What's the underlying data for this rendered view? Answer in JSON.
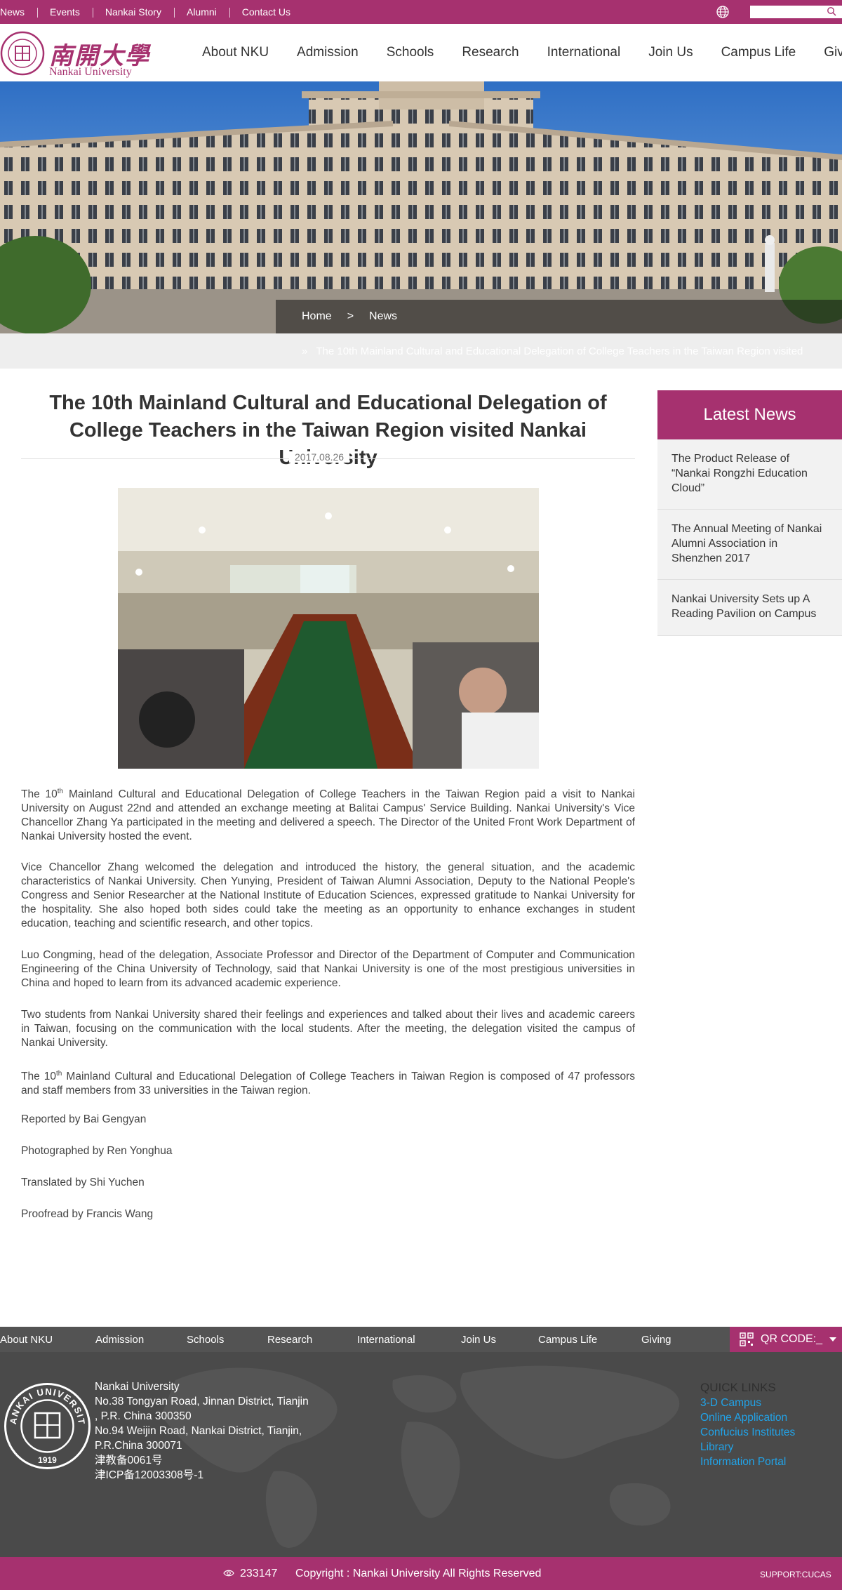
{
  "topbar": {
    "links": [
      "News",
      "Events",
      "Nankai Story",
      "Alumni",
      "Contact Us"
    ],
    "search_placeholder": ""
  },
  "header": {
    "logo_cn": "南開大學",
    "logo_en": "Nankai University",
    "nav": [
      "About NKU",
      "Admission",
      "Schools",
      "Research",
      "International",
      "Join Us",
      "Campus Life",
      "Giving"
    ]
  },
  "breadcrumb": {
    "home": "Home",
    "separator": ">",
    "current": "News",
    "trail_arrow": "»",
    "trail_title": "The 10th Mainland Cultural and Educational Delegation of College Teachers in the Taiwan Region visited"
  },
  "article": {
    "title_line1": "The 10th Mainland Cultural and Educational Delegation of",
    "title_line2": "College Teachers in the Taiwan Region visited Nankai University",
    "date": "2017.08.26",
    "p1_a": "The 10",
    "p1_sup": "th",
    "p1_b": " Mainland Cultural and Educational Delegation of College Teachers in the Taiwan Region paid a visit to Nankai University on August 22nd and attended an exchange meeting at Balitai Campus' Service Building. Nankai University's Vice Chancellor Zhang Ya participated in the meeting and delivered a speech. The Director of the United Front Work Department of Nankai University hosted the event.",
    "p2": "Vice Chancellor Zhang welcomed the delegation and introduced the history, the general situation, and the academic characteristics of Nankai University. Chen Yunying, President of Taiwan Alumni Association, Deputy to the National People's Congress and Senior Researcher at the National Institute of Education Sciences, expressed gratitude to Nankai University for the hospitality. She also hoped both sides could take the meeting as an opportunity to enhance exchanges in student education, teaching and scientific research, and other topics.",
    "p3": "Luo Congming, head of the delegation, Associate Professor and Director of the Department of Computer and Communication Engineering of the China University of Technology, said that Nankai University is one of the most prestigious universities in China and hoped to learn from its advanced academic experience.",
    "p4": "Two students from Nankai University shared their feelings and experiences and talked about their lives and academic careers in Taiwan, focusing on the communication with the local students. After the meeting, the delegation visited the campus of Nankai University.",
    "p5_a": "The 10",
    "p5_sup": "th",
    "p5_b": " Mainland Cultural and Educational Delegation of College Teachers in Taiwan Region is composed of 47 professors and staff members from 33 universities in the Taiwan region.",
    "credits": [
      "Reported by Bai Gengyan",
      "Photographed by Ren Yonghua",
      "Translated by Shi Yuchen",
      "Proofread by Francis Wang"
    ]
  },
  "sidebar": {
    "title": "Latest News",
    "items": [
      "The Product Release of “Nankai Rongzhi Education Cloud”",
      "The Annual Meeting of Nankai Alumni Association in Shenzhen 2017",
      "Nankai University Sets up A Reading Pavilion on Campus"
    ]
  },
  "footer": {
    "nav": [
      "About NKU",
      "Admission",
      "Schools",
      "Research",
      "International",
      "Join Us",
      "Campus Life",
      "Giving"
    ],
    "qr_label": "QR CODE:_",
    "address_lines": [
      "Nankai University",
      "No.38 Tongyan Road, Jinnan District, Tianjin",
      ", P.R. China 300350",
      "No.94 Weijin Road,  Nankai District, Tianjin,",
      "P.R.China  300071",
      "津教备0061号",
      "津ICP备12003308号-1"
    ],
    "seal_text_top": "NANKAI UNIVERSITY",
    "seal_year": "1919",
    "quick_title": "QUICK LINKS",
    "quick_links": [
      "3-D Campus",
      "Online Application",
      "Confucius Institutes",
      "Library",
      "Information Portal"
    ],
    "visits": "233147",
    "copyright": "Copyright : Nankai University All Rights Reserved",
    "support": "SUPPORT:CUCAS"
  },
  "colors": {
    "brand": "#a6316f",
    "footer_dark": "#4a4a4a",
    "link_blue": "#21a3e8"
  }
}
